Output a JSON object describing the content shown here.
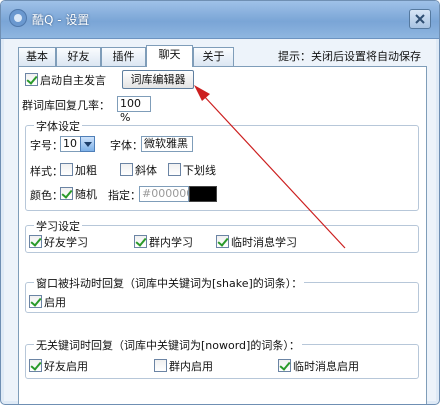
{
  "window": {
    "title": "酷Q - 设置"
  },
  "tabs": [
    "基本",
    "好友",
    "插件",
    "聊天",
    "关于"
  ],
  "active_tab": "聊天",
  "hint": "提示：关闭后设置将自动保存",
  "chat": {
    "auto_speak_label": "启动自主发言",
    "auto_speak_checked": true,
    "lexicon_editor_button": "词库编辑器",
    "reply_rate_label": "群词库回复几率：",
    "reply_rate_value": "100 %"
  },
  "font_group": {
    "title": "字体设定",
    "size_label": "字号：",
    "size_value": "10",
    "font_label": "字体：",
    "font_value": "微软雅黑",
    "style_label": "样式：",
    "bold_label": "加粗",
    "bold_checked": false,
    "italic_label": "斜体",
    "italic_checked": false,
    "underline_label": "下划线",
    "underline_checked": false,
    "color_label": "颜色：",
    "random_label": "随机",
    "random_checked": true,
    "specify_label": "指定：",
    "color_value": "#000000",
    "swatch_color": "#000000"
  },
  "study_group": {
    "title": "学习设定",
    "friend_label": "好友学习",
    "friend_checked": true,
    "group_label": "群内学习",
    "group_checked": true,
    "temp_label": "临时消息学习",
    "temp_checked": true
  },
  "shake_group": {
    "title": "窗口被抖动时回复（词库中关键词为[shake]的词条）：",
    "enable_label": "启用",
    "enable_checked": true
  },
  "noword_group": {
    "title": "无关键词时回复（词库中关键词为[noword]的词条）：",
    "friend_label": "好友启用",
    "friend_checked": true,
    "group_label": "群内启用",
    "group_checked": false,
    "temp_label": "临时消息启用",
    "temp_checked": true
  },
  "annotation_color": "#cc1f1f",
  "icons": [
    "app-icon",
    "close-icon",
    "dropdown-arrow-icon"
  ]
}
